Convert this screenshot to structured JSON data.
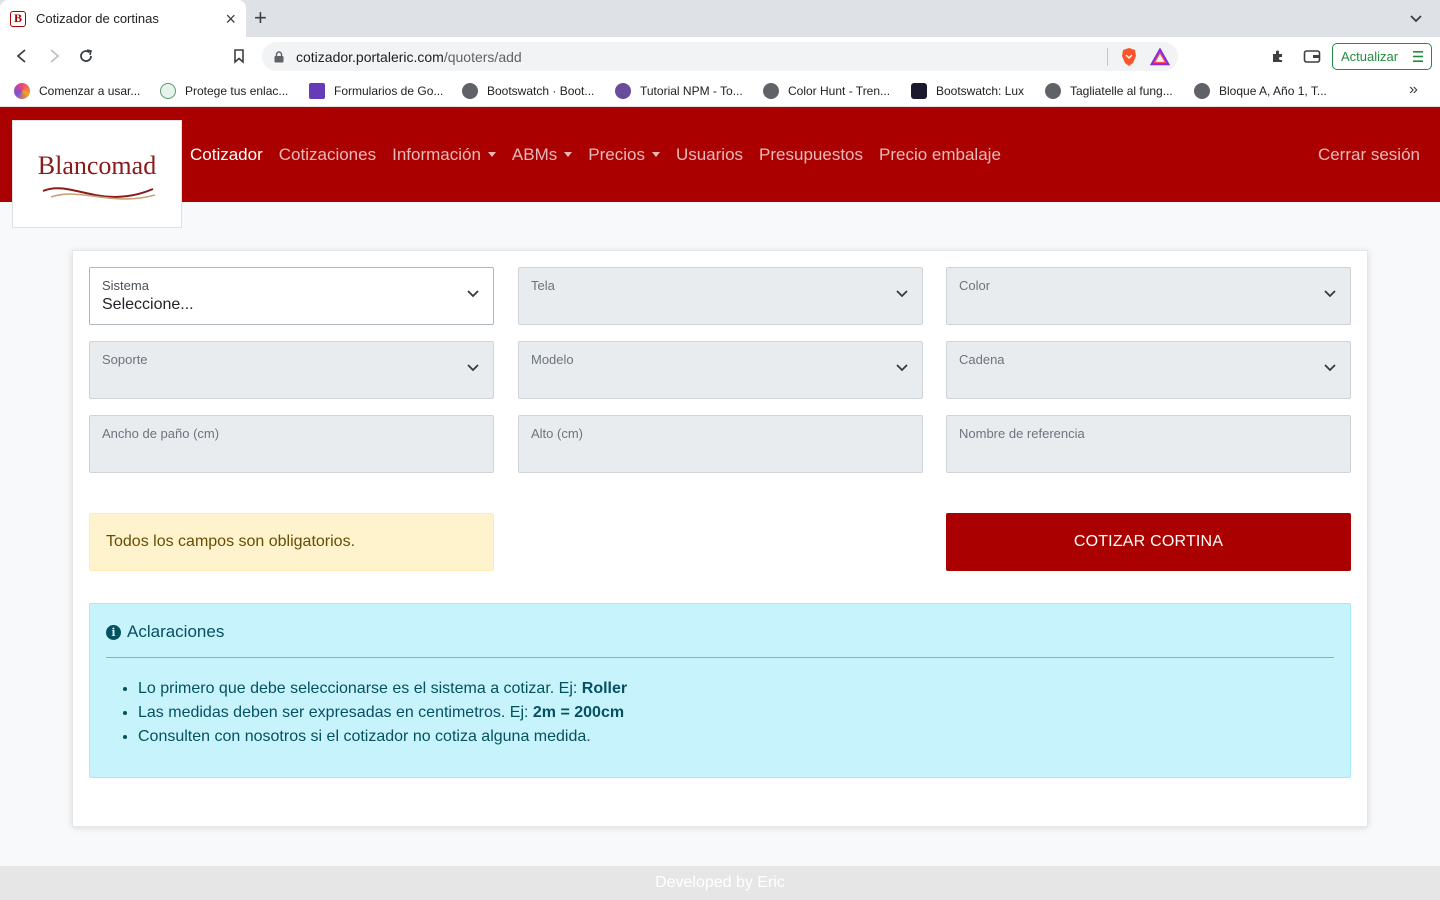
{
  "browser": {
    "tab_title": "Cotizador de cortinas",
    "url_host": "cotizador.portaleric.com",
    "url_path": "/quoters/add",
    "update_label": "Actualizar",
    "bookmarks": [
      {
        "label": "Comenzar a usar...",
        "icon": "colorful-ball-icon",
        "color": "#e8467c"
      },
      {
        "label": "Protege tus enlac...",
        "icon": "link-icon",
        "color": "#5b9b6e"
      },
      {
        "label": "Formularios de Go...",
        "icon": "forms-icon",
        "color": "#673ab7"
      },
      {
        "label": "Bootswatch · Boot...",
        "icon": "globe-icon",
        "color": "#5f6368"
      },
      {
        "label": "Tutorial NPM - To...",
        "icon": "potion-icon",
        "color": "#6a4c9c"
      },
      {
        "label": "Color Hunt - Tren...",
        "icon": "globe-icon",
        "color": "#5f6368"
      },
      {
        "label": "Bootswatch: Lux",
        "icon": "bootswatch-icon",
        "color": "#1a1a2e"
      },
      {
        "label": "Tagliatelle al fung...",
        "icon": "globe-icon",
        "color": "#5f6368"
      },
      {
        "label": "Bloque A, Año 1, T...",
        "icon": "globe-icon",
        "color": "#5f6368"
      }
    ]
  },
  "navbar": {
    "brand": "Blancomad",
    "links": [
      {
        "label": "Cotizador",
        "active": true,
        "dropdown": false
      },
      {
        "label": "Cotizaciones",
        "active": false,
        "dropdown": false
      },
      {
        "label": "Información",
        "active": false,
        "dropdown": true
      },
      {
        "label": "ABMs",
        "active": false,
        "dropdown": true
      },
      {
        "label": "Precios",
        "active": false,
        "dropdown": true
      },
      {
        "label": "Usuarios",
        "active": false,
        "dropdown": false
      },
      {
        "label": "Presupuestos",
        "active": false,
        "dropdown": false
      },
      {
        "label": "Precio embalaje",
        "active": false,
        "dropdown": false
      }
    ],
    "logout": "Cerrar sesión",
    "color": "#aa0000"
  },
  "form": {
    "fields": [
      {
        "label": "Sistema",
        "value": "Seleccione...",
        "type": "select",
        "enabled": true
      },
      {
        "label": "Tela",
        "value": "",
        "type": "select",
        "enabled": false
      },
      {
        "label": "Color",
        "value": "",
        "type": "select",
        "enabled": false
      },
      {
        "label": "Soporte",
        "value": "",
        "type": "select",
        "enabled": false
      },
      {
        "label": "Modelo",
        "value": "",
        "type": "select",
        "enabled": false
      },
      {
        "label": "Cadena",
        "value": "",
        "type": "select",
        "enabled": false
      },
      {
        "label": "Ancho de paño (cm)",
        "value": "",
        "type": "input",
        "enabled": false
      },
      {
        "label": "Alto (cm)",
        "value": "",
        "type": "input",
        "enabled": false
      },
      {
        "label": "Nombre de referencia",
        "value": "",
        "type": "input",
        "enabled": false
      }
    ],
    "warning": "Todos los campos son obligatorios.",
    "submit_label": "COTIZAR CORTINA"
  },
  "info": {
    "title": "Aclaraciones",
    "items": [
      {
        "text": "Lo primero que debe seleccionarse es el sistema a cotizar. Ej: ",
        "bold": "Roller"
      },
      {
        "text": "Las medidas deben ser expresadas en centimetros. Ej: ",
        "bold": "2m = 200cm"
      },
      {
        "text": "Consulten con nosotros si el cotizador no cotiza alguna medida.",
        "bold": ""
      }
    ]
  },
  "footer": "Developed by Eric"
}
